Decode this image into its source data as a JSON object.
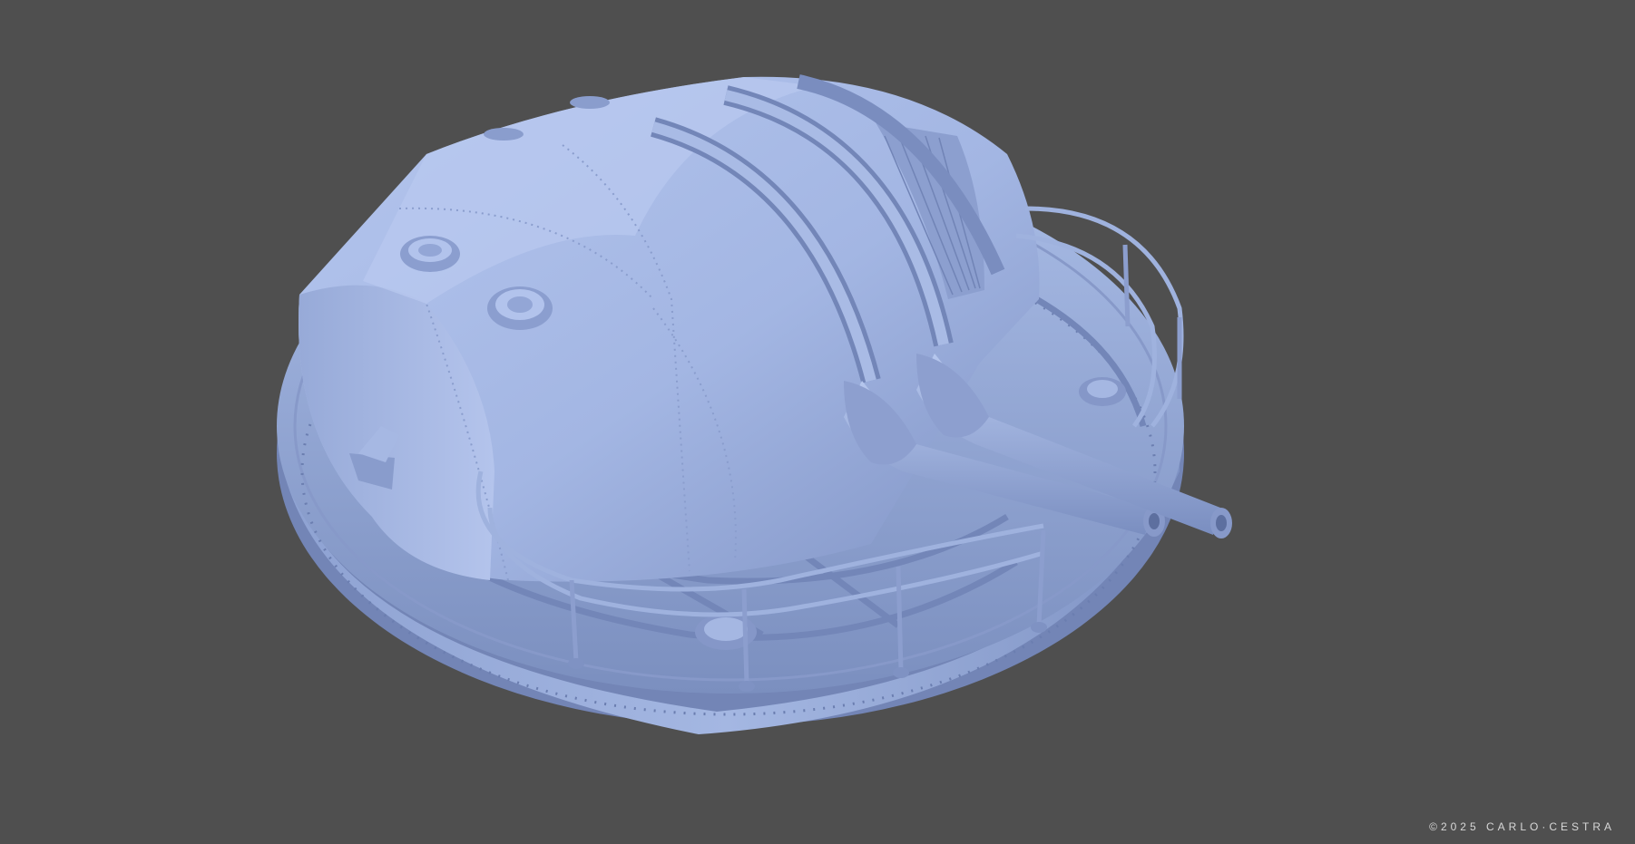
{
  "render": {
    "subject": "twin-gun-turret-clay-render",
    "background_color": "#4f4f4f",
    "model_color": "#9aafdc",
    "shadow_color": "#6d80ad",
    "highlight_color": "#b6c7ee"
  },
  "credit": "©2025 CARLO·CESTRA"
}
